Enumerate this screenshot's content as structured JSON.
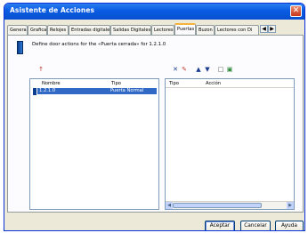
{
  "window": {
    "title": "Asistente de Acciones",
    "close_glyph": "✕"
  },
  "tabs": [
    "General",
    "Grafica|",
    "Relojes",
    "Entradas digitales",
    "Salidas Digitales",
    "Lectores",
    "Puertas",
    "Buzon",
    "Lectores con Di"
  ],
  "active_tab": "Puertas",
  "tab_scroll": {
    "left": "◀",
    "right": "▶"
  },
  "description": "Define door actions for the «Puerta cerrada» for 1.2.1.0",
  "left_list": {
    "columns": [
      "Nombre",
      "Tipo"
    ],
    "rows": [
      {
        "nombre": "1.2.1.0",
        "tipo": "Puerta Normal"
      }
    ]
  },
  "right_list": {
    "columns": [
      "Tipo",
      "Acción"
    ],
    "rows": []
  },
  "toolbar": {
    "delete": "✕",
    "edit": "✎",
    "up": "▲",
    "down": "▼",
    "new": "□",
    "copy": "▣",
    "add": "↑"
  },
  "buttons": {
    "accept": "Aceptar",
    "cancel": "Cancelar",
    "help": "Ayuda"
  }
}
